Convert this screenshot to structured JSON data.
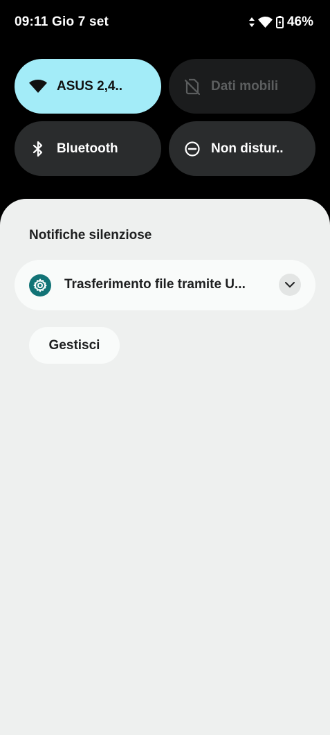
{
  "status_bar": {
    "time": "09:11",
    "date": "Gio 7 set",
    "battery_percent": "46%",
    "icons": [
      "data-activity-icon",
      "wifi-icon",
      "battery-charging-icon"
    ]
  },
  "quick_settings": {
    "wifi": {
      "label": "ASUS 2,4..",
      "icon": "wifi-icon",
      "state": "on",
      "color": "#a3ecf8"
    },
    "mobile_data": {
      "label": "Dati mobili",
      "icon": "no-sim-icon",
      "state": "unavailable"
    },
    "bluetooth": {
      "label": "Bluetooth",
      "icon": "bluetooth-icon",
      "state": "off"
    },
    "do_not_disturb": {
      "label": "Non distur..",
      "icon": "do-not-disturb-icon",
      "state": "off"
    }
  },
  "notifications": {
    "section_title": "Notifiche silenziose",
    "items": [
      {
        "title": "Trasferimento file tramite U...",
        "app_icon": "settings-gear-icon",
        "app_icon_color": "#127376"
      }
    ],
    "manage_label": "Gestisci"
  }
}
